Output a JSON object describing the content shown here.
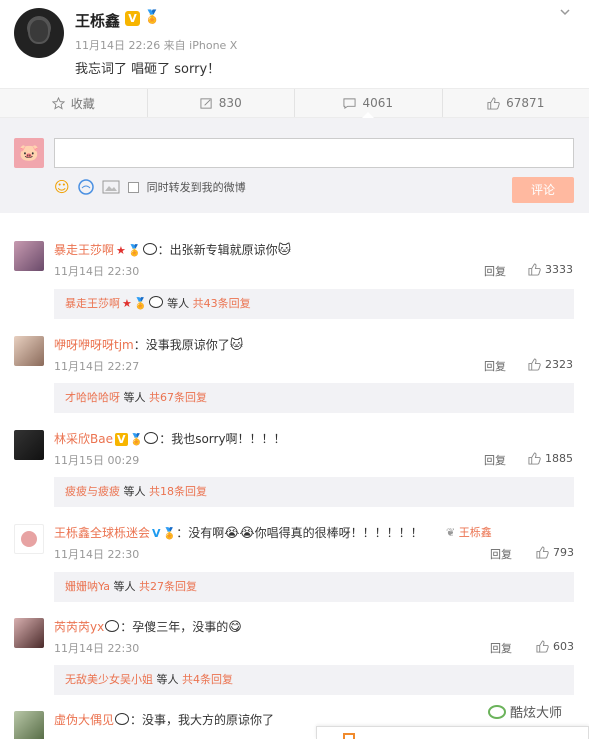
{
  "post": {
    "author": "王栎鑫",
    "vip_badge": "V",
    "medal_icon": "medal-icon",
    "meta": "11月14日 22:26 来自 iPhone X",
    "text": "我忘词了 唱砸了 sorry！"
  },
  "actions": [
    {
      "icon": "star-icon",
      "label": "收藏"
    },
    {
      "icon": "repost-icon",
      "label": "830"
    },
    {
      "icon": "comment-icon",
      "label": "4061"
    },
    {
      "icon": "like-icon",
      "label": "67871"
    }
  ],
  "compose": {
    "input_value": "",
    "repost_label": "同时转发到我的微博",
    "submit_label": "评论"
  },
  "comments": [
    {
      "user": "暴走王莎啊",
      "text": "：出张新专辑就原谅你",
      "time": "11月14日 22:30",
      "reply": "回复",
      "likes": "3333",
      "sub_user": "暴走王莎啊",
      "sub_mid": " 等人 ",
      "sub_count": "共43条回复"
    },
    {
      "user": "咿呀咿呀呀tjm",
      "text": "：没事我原谅你了",
      "time": "11月14日 22:27",
      "reply": "回复",
      "likes": "2323",
      "sub_user": "才哈哈哈呀",
      "sub_mid": " 等人 ",
      "sub_count": "共67条回复"
    },
    {
      "user": "林采欣Bae",
      "text": "：我也sorry啊！！！！",
      "time": "11月15日 00:29",
      "reply": "回复",
      "likes": "1885",
      "sub_user": "疲疲与疲疲",
      "sub_mid": " 等人 ",
      "sub_count": "共18条回复"
    },
    {
      "user": "王栎鑫全球栎迷会",
      "text": "：没有啊",
      "text2": "你唱得真的很棒呀！！！！！！",
      "fan_group": "王栎鑫",
      "time": "11月14日 22:30",
      "reply": "回复",
      "likes": "793",
      "sub_user": "姗姗呐Ya",
      "sub_mid": " 等人 ",
      "sub_count": "共27条回复"
    },
    {
      "user": "芮芮芮yx",
      "text": "：孕傻三年，没事的",
      "time": "11月14日 22:30",
      "reply": "回复",
      "likes": "603",
      "sub_user": "无敌美少女吴小姐",
      "sub_mid": " 等人 ",
      "sub_count": "共4条回复"
    },
    {
      "user": "虚伪大偶见",
      "text": "：没事，我大方的原谅你了",
      "time": "",
      "reply": "",
      "likes": ""
    }
  ],
  "watermark": "酷炫大师",
  "colors": {
    "accent": "#eb7350",
    "submit_bg": "#ffb9a0",
    "panel_bg": "#f2f2f5"
  }
}
